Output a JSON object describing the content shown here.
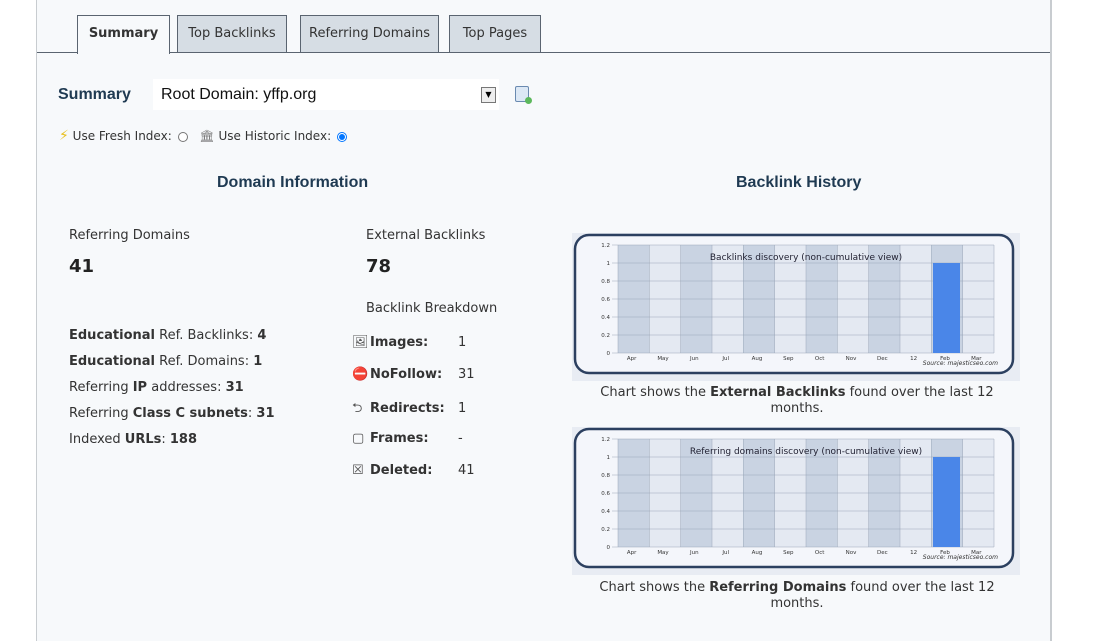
{
  "tabs": [
    {
      "label": "Summary",
      "active": true
    },
    {
      "label": "Top Backlinks"
    },
    {
      "label": "Referring Domains"
    },
    {
      "label": "Top Pages"
    }
  ],
  "summary": {
    "label": "Summary",
    "select_value": "Root Domain: yffp.org"
  },
  "index": {
    "fresh_label": "Use Fresh Index:",
    "historic_label": "Use Historic Index:",
    "selected": "historic"
  },
  "domain_info": {
    "title": "Domain Information",
    "ref_domains_label": "Referring Domains",
    "ref_domains_value": "41",
    "ext_backlinks_label": "External Backlinks",
    "ext_backlinks_value": "78",
    "breakdown_label": "Backlink Breakdown",
    "stats": [
      {
        "bold": "Educational",
        "text": " Ref. Backlinks: ",
        "value": "4"
      },
      {
        "bold": "Educational",
        "text": " Ref. Domains: ",
        "value": "1"
      },
      {
        "pre": "Referring ",
        "bold": "IP",
        "text": " addresses: ",
        "value": "31"
      },
      {
        "pre": "Referring ",
        "bold": "Class C subnets",
        "text": ": ",
        "value": "31"
      },
      {
        "pre": "Indexed ",
        "bold": "URLs",
        "text": ": ",
        "value": "188"
      }
    ],
    "breakdown": [
      {
        "label": "Images:",
        "value": "1"
      },
      {
        "label": "NoFollow:",
        "value": "31"
      },
      {
        "label": "Redirects:",
        "value": "1"
      },
      {
        "label": "Frames:",
        "value": "-"
      },
      {
        "label": "Deleted:",
        "value": "41"
      }
    ]
  },
  "history": {
    "title": "Backlink History",
    "captions": [
      {
        "pre": "Chart shows the ",
        "bold": "External Backlinks",
        "post": " found over the last 12 months."
      },
      {
        "pre": "Chart shows the ",
        "bold": "Referring Domains",
        "post": " found over the last 12 months."
      }
    ]
  },
  "chart_data": [
    {
      "type": "bar",
      "title": "Backlinks discovery (non-cumulative view)",
      "categories": [
        "Apr",
        "May",
        "Jun",
        "Jul",
        "Aug",
        "Sep",
        "Oct",
        "Nov",
        "Dec",
        "12",
        "Feb",
        "Mar"
      ],
      "values": [
        0,
        0,
        0,
        0,
        0,
        0,
        0,
        0,
        0,
        0,
        1,
        0
      ],
      "yticks": [
        "0",
        "0.2",
        "0.4",
        "0.6",
        "0.8",
        "1",
        "1.2"
      ],
      "ylim": [
        0,
        1.2
      ],
      "source": "Source: majesticseo.com",
      "color": "#4a86e8"
    },
    {
      "type": "bar",
      "title": "Referring domains discovery (non-cumulative view)",
      "categories": [
        "Apr",
        "May",
        "Jun",
        "Jul",
        "Aug",
        "Sep",
        "Oct",
        "Nov",
        "Dec",
        "12",
        "Feb",
        "Mar"
      ],
      "values": [
        0,
        0,
        0,
        0,
        0,
        0,
        0,
        0,
        0,
        0,
        1,
        0
      ],
      "yticks": [
        "0",
        "0.2",
        "0.4",
        "0.6",
        "0.8",
        "1",
        "1.2"
      ],
      "ylim": [
        0,
        1.2
      ],
      "source": "Source: majesticseo.com",
      "color": "#4a86e8"
    }
  ]
}
